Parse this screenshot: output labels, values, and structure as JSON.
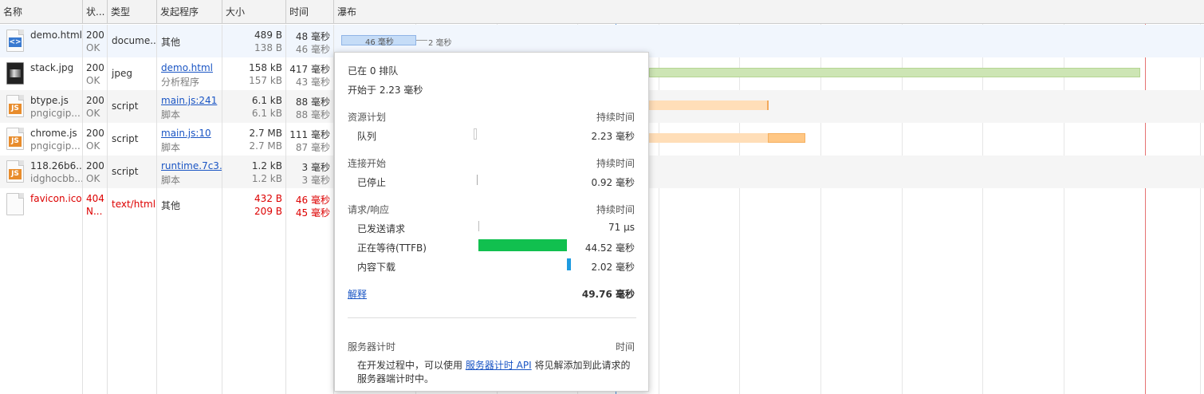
{
  "columns": {
    "name": "名称",
    "status": "状...",
    "type": "类型",
    "initiator": "发起程序",
    "size": "大小",
    "time": "时间",
    "waterfall": "瀑布"
  },
  "rows": [
    {
      "name": "demo.html",
      "name_sub": "",
      "status": "200",
      "status_sub": "OK",
      "type": "docume...",
      "initiator": "其他",
      "initiator_sub": "",
      "size": "489 B",
      "size_sub": "138 B",
      "time": "48 毫秒",
      "time_sub": "46 毫秒",
      "icon": "html-file-icon"
    },
    {
      "name": "stack.jpg",
      "name_sub": "",
      "status": "200",
      "status_sub": "OK",
      "type": "jpeg",
      "initiator": "demo.html",
      "initiator_sub": "分析程序",
      "size": "158 kB",
      "size_sub": "157 kB",
      "time": "417 毫秒",
      "time_sub": "43 毫秒",
      "icon": "image-file-icon"
    },
    {
      "name": "btype.js",
      "name_sub": "pngicgip...",
      "status": "200",
      "status_sub": "OK",
      "type": "script",
      "initiator": "main.js:241",
      "initiator_sub": "脚本",
      "size": "6.1 kB",
      "size_sub": "6.1 kB",
      "time": "88 毫秒",
      "time_sub": "88 毫秒",
      "icon": "js-file-icon"
    },
    {
      "name": "chrome.js",
      "name_sub": "pngicgip...",
      "status": "200",
      "status_sub": "OK",
      "type": "script",
      "initiator": "main.js:10",
      "initiator_sub": "脚本",
      "size": "2.7 MB",
      "size_sub": "2.7 MB",
      "time": "111 毫秒",
      "time_sub": "87 毫秒",
      "icon": "js-file-icon"
    },
    {
      "name": "118.26b6...",
      "name_sub": "idghocbb...",
      "status": "200",
      "status_sub": "OK",
      "type": "script",
      "initiator": "runtime.7c3...",
      "initiator_sub": "脚本",
      "size": "1.2 kB",
      "size_sub": "1.2 kB",
      "time": "3 毫秒",
      "time_sub": "3 毫秒",
      "icon": "js-file-icon"
    },
    {
      "name": "favicon.ico",
      "name_sub": "",
      "status": "404",
      "status_sub": "N...",
      "type": "text/html",
      "initiator": "其他",
      "initiator_sub": "",
      "size": "432 B",
      "size_sub": "209 B",
      "time": "46 毫秒",
      "time_sub": "45 毫秒",
      "icon": "blank-file-icon"
    }
  ],
  "waterfall": {
    "demo_bar_label": "46 毫秒",
    "demo_tail_label": "2 毫秒"
  },
  "popup": {
    "queued_at": "已在 0 排队",
    "started_at": "开始于 2.23 毫秒",
    "sections": [
      {
        "title": "资源计划",
        "col": "持续时间",
        "items": [
          {
            "label": "队列",
            "value": "2.23 毫秒"
          }
        ]
      },
      {
        "title": "连接开始",
        "col": "持续时间",
        "items": [
          {
            "label": "已停止",
            "value": "0.92 毫秒"
          }
        ]
      },
      {
        "title": "请求/响应",
        "col": "持续时间",
        "items": [
          {
            "label": "已发送请求",
            "value": "71 µs"
          },
          {
            "label": "正在等待(TTFB)",
            "value": "44.52 毫秒"
          },
          {
            "label": "内容下载",
            "value": "2.02 毫秒"
          }
        ]
      }
    ],
    "explain_link": "解释",
    "total": "49.76 毫秒",
    "server_timing_title": "服务器计时",
    "server_timing_col": "时间",
    "server_note_1": "在开发过程中，可以使用",
    "server_note_link": "服务器计时 API",
    "server_note_2": "将见解添加到此请求的",
    "server_note_3": "服务器端计时中。"
  },
  "colors": {
    "ttfb": "#11c04f",
    "download": "#1e9be0",
    "image_bar": "#cde5b4",
    "script_bar": "#ffdeb8",
    "script_bar_dark": "#ffc784",
    "error_text": "#d00000"
  }
}
